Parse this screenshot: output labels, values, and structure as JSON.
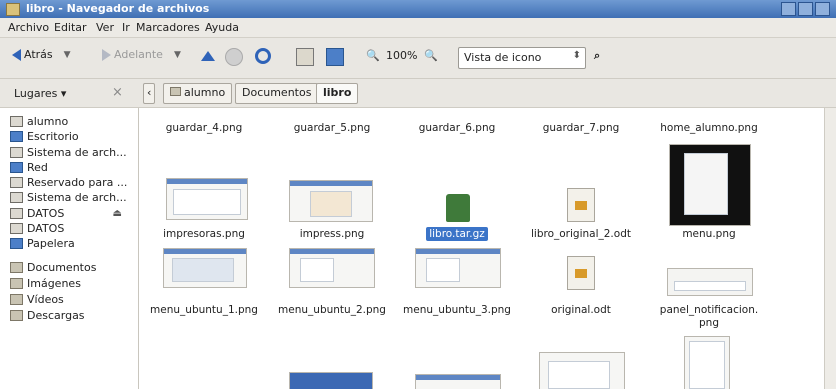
{
  "window": {
    "title": "libro - Navegador de archivos"
  },
  "menu": [
    "Archivo",
    "Editar",
    "Ver",
    "Ir",
    "Marcadores",
    "Ayuda"
  ],
  "toolbar": {
    "back_label": "Atrás",
    "forward_label": "Adelante",
    "zoom_value": "100%",
    "view_mode": "Vista de icono"
  },
  "places": {
    "header": "Lugares"
  },
  "breadcrumbs": [
    "alumno",
    "Documentos",
    "libro"
  ],
  "sidebar": [
    {
      "label": "alumno",
      "icon": "home-icon"
    },
    {
      "label": "Escritorio",
      "icon": "desktop-icon"
    },
    {
      "label": "Sistema de arch...",
      "icon": "drive-icon"
    },
    {
      "label": "Red",
      "icon": "network-icon"
    },
    {
      "label": "Reservado para ...",
      "icon": "drive-icon"
    },
    {
      "label": "Sistema de arch...",
      "icon": "drive-icon"
    },
    {
      "label": "DATOS",
      "icon": "drive-icon",
      "eject": true
    },
    {
      "label": "DATOS",
      "icon": "drive-icon"
    },
    {
      "label": "Papelera",
      "icon": "trash-icon"
    },
    {
      "label": "Documentos",
      "icon": "folder-icon"
    },
    {
      "label": "Imágenes",
      "icon": "folder-icon"
    },
    {
      "label": "Vídeos",
      "icon": "folder-icon"
    },
    {
      "label": "Descargas",
      "icon": "folder-icon"
    }
  ],
  "files": {
    "row1": [
      "guardar_4.png",
      "guardar_5.png",
      "guardar_6.png",
      "guardar_7.png",
      "home_alumno.png"
    ],
    "row2": [
      "impresoras.png",
      "impress.png",
      "libro.tar.gz",
      "libro_original_2.odt",
      "menu.png"
    ],
    "row3": [
      "menu_ubuntu_1.png",
      "menu_ubuntu_2.png",
      "menu_ubuntu_3.png",
      "original.odt",
      "panel_notificacion.",
      "png"
    ]
  },
  "selected_file": "libro.tar.gz"
}
